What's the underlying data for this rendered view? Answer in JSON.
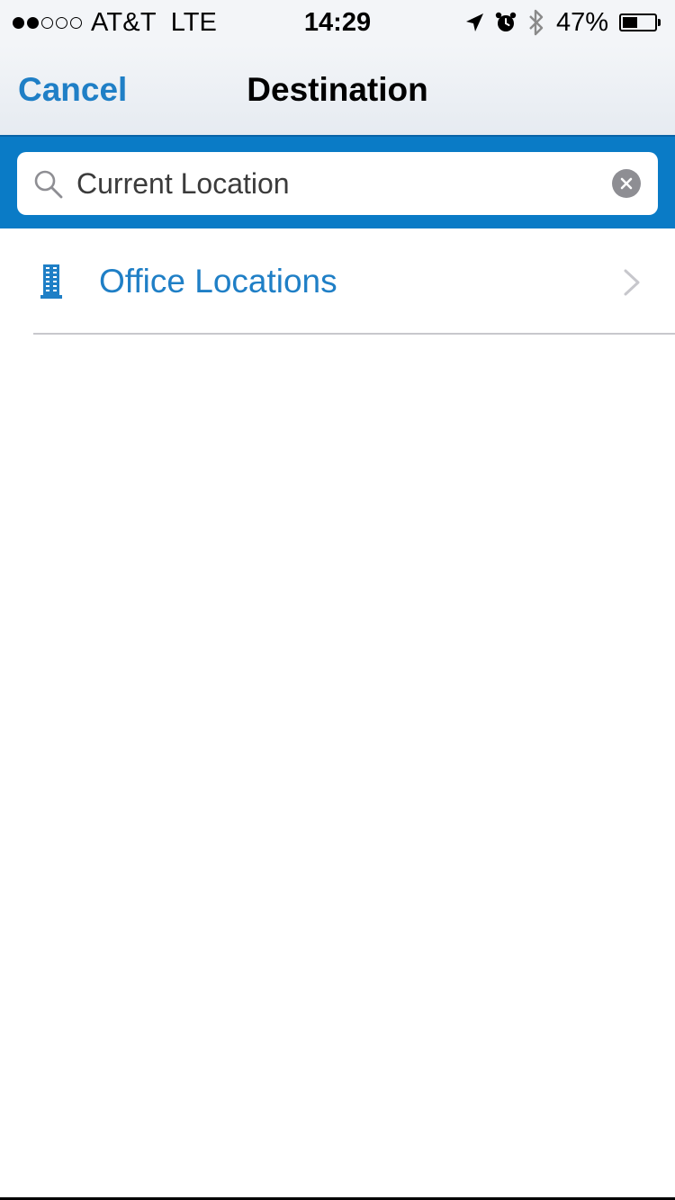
{
  "status_bar": {
    "carrier": "AT&T",
    "network": "LTE",
    "time": "14:29",
    "battery": "47%",
    "battery_level": 0.47,
    "signal_strength": 2,
    "icons": [
      "location-arrow-icon",
      "alarm-icon",
      "bluetooth-icon",
      "battery-icon"
    ]
  },
  "nav": {
    "cancel_label": "Cancel",
    "title": "Destination"
  },
  "search": {
    "value": "Current Location",
    "icon": "search-icon",
    "clear_icon": "clear-icon"
  },
  "list": {
    "items": [
      {
        "label": "Office Locations",
        "icon": "office-building-icon"
      }
    ]
  },
  "colors": {
    "accent": "#1f7fc6",
    "search_band": "#0a7bc6",
    "nav_bg": "#f3f5f8"
  }
}
